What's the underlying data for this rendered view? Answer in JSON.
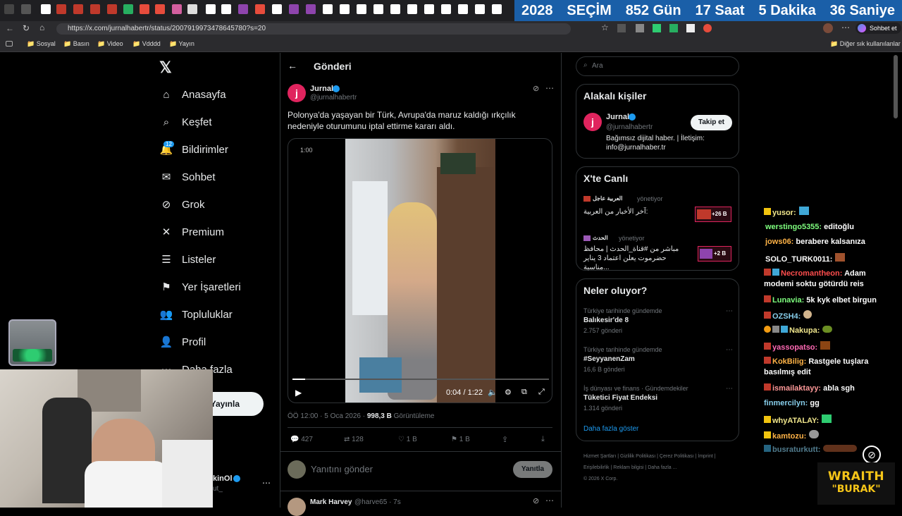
{
  "countdown": {
    "year": "2028",
    "label": "SEÇİM",
    "days": "852 Gün",
    "hours": "17 Saat",
    "minutes": "5 Dakika",
    "seconds": "36 Saniye"
  },
  "browser": {
    "url": "https://x.com/jurnalhabertr/status/2007919973478645780?s=20",
    "chat_button": "Sohbet et",
    "bookmarks": [
      "Sosyal",
      "Basın",
      "Video",
      "Vdddd",
      "Yayın"
    ],
    "other_bookmarks": "Diğer sık kullanılanlar"
  },
  "nav": {
    "items": [
      "Anasayfa",
      "Keşfet",
      "Bildirimler",
      "Sohbet",
      "Grok",
      "Premium",
      "Listeler",
      "Yer İşaretleri",
      "Topluluklar",
      "Profil",
      "Daha fazla"
    ],
    "notif_badge": "12",
    "post_button": "Yayınla",
    "account_name": "kinOl",
    "account_handle": "ut_"
  },
  "post": {
    "header": "Gönderi",
    "author": "Jurnal",
    "handle": "@jurnalhabertr",
    "text": "Polonya'da yaşayan bir Türk, Avrupa'da maruz kaldığı ırkçılık nedeniyle oturumunu iptal ettirme kararı aldı.",
    "video_remaining": "1:00",
    "video_time": "0:04 / 1:22",
    "timestamp": "ÖÖ 12:00 · 5 Oca 2026 ·",
    "views": "998,3 B",
    "views_label": "Görüntüleme",
    "replies": "427",
    "reposts": "128",
    "likes": "1 B",
    "bookmarks": "1 B",
    "reply_placeholder": "Yanıtını gönder",
    "reply_button": "Yanıtla",
    "next_author": "Mark Harvey",
    "next_handle": "@harve65 · 7s"
  },
  "search": {
    "placeholder": "Ara"
  },
  "related": {
    "title": "Alakalı kişiler",
    "name": "Jurnal",
    "handle": "@jurnalhabertr",
    "follow": "Takip et",
    "bio": "Bağımsız dijital haber. | İletişim: info@jurnalhaber.tr"
  },
  "live": {
    "title": "X'te Canlı",
    "items": [
      {
        "channel": "العربية عاجل",
        "status": "yönetiyor",
        "title": "آخر الأخبار من العربية:",
        "count": "+26 B"
      },
      {
        "channel": "الحدث",
        "status": "yönetiyor",
        "title": "مباشر من #قناة_الحدث | محافظ حضرموت يعلن اعتماد 3 يناير مناسبة...",
        "count": "+2 B"
      }
    ]
  },
  "trends": {
    "title": "Neler oluyor?",
    "items": [
      {
        "context": "Türkiye tarihinde gündemde",
        "name": "Balıkesir'de 8",
        "count": "2.757 gönderi"
      },
      {
        "context": "Türkiye tarihinde gündemde",
        "name": "#SeyyanenZam",
        "count": "16,6 B gönderi"
      },
      {
        "context": "İş dünyası ve finans · Gündemdekiler",
        "name": "Tüketici Fiyat Endeksi",
        "count": "1.314 gönderi"
      }
    ],
    "show_more": "Daha fazla göster"
  },
  "footer": {
    "links": [
      "Hizmet Şartları",
      "Gizlilik Politikası",
      "Çerez Politikası",
      "İmprint",
      "Erişilebilirlik",
      "Reklam bilgisi",
      "Daha fazla ..."
    ],
    "copyright": "© 2026 X Corp."
  },
  "chat": [
    {
      "user": "yusor:",
      "msg": "",
      "color": "#f0e68c"
    },
    {
      "user": "werstingo5355:",
      "msg": "editoğlu",
      "color": "#7fff7f"
    },
    {
      "user": "jows06:",
      "msg": "berabere kalsanıza",
      "color": "#ffb347"
    },
    {
      "user": "SOLO_TURK0011:",
      "msg": "",
      "color": "#ffffff"
    },
    {
      "user": "Necromantheon:",
      "msg": "Adam",
      "color": "#ff4d4d"
    },
    {
      "user": "",
      "msg": "modemi soktu götürdü reis",
      "color": "#ffffff"
    },
    {
      "user": "Lunavia:",
      "msg": "5k kyk elbet birgun",
      "color": "#7fff7f"
    },
    {
      "user": "OZSH4:",
      "msg": "",
      "color": "#87ceeb"
    },
    {
      "user": "Nakupa:",
      "msg": "",
      "color": "#f0e68c"
    },
    {
      "user": "yassopatso:",
      "msg": "",
      "color": "#ff69b4"
    },
    {
      "user": "KokBilig:",
      "msg": "Rastgele tuşlara",
      "color": "#ffb347"
    },
    {
      "user": "",
      "msg": "basılmış edit",
      "color": "#ffffff"
    },
    {
      "user": "ismailaktayy:",
      "msg": "abla sgh",
      "color": "#ff9999"
    },
    {
      "user": "finmercilyn:",
      "msg": "gg",
      "color": "#87ceeb"
    },
    {
      "user": "whyATALAY:",
      "msg": "",
      "color": "#f0e68c"
    },
    {
      "user": "kamtozu:",
      "msg": "",
      "color": "#ffb347"
    },
    {
      "user": "busraturkutt:",
      "msg": "",
      "color": "#87ceeb"
    }
  ],
  "streamer": {
    "line1": "WRAITH",
    "line2": "\"BURAK\""
  },
  "colors": {
    "accent": "#1d9bf0",
    "countdown_bg": "#1a5fa8",
    "jurnal_red": "#e0245e"
  }
}
